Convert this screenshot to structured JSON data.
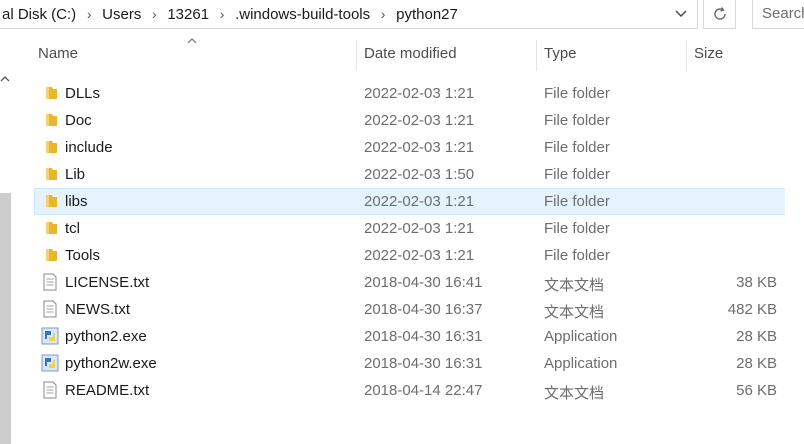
{
  "breadcrumb": [
    "al Disk (C:)",
    "Users",
    "13261",
    ".windows-build-tools",
    "python27"
  ],
  "search_placeholder": "Search",
  "columns": {
    "name": "Name",
    "date": "Date modified",
    "type": "Type",
    "size": "Size"
  },
  "files": [
    {
      "name": "DLLs",
      "date": "2022-02-03 1:21",
      "type": "File folder",
      "size": "",
      "icon": "folder-icon"
    },
    {
      "name": "Doc",
      "date": "2022-02-03 1:21",
      "type": "File folder",
      "size": "",
      "icon": "folder-icon"
    },
    {
      "name": "include",
      "date": "2022-02-03 1:21",
      "type": "File folder",
      "size": "",
      "icon": "folder-icon"
    },
    {
      "name": "Lib",
      "date": "2022-02-03 1:50",
      "type": "File folder",
      "size": "",
      "icon": "folder-icon"
    },
    {
      "name": "libs",
      "date": "2022-02-03 1:21",
      "type": "File folder",
      "size": "",
      "icon": "folder-icon",
      "selected": true
    },
    {
      "name": "tcl",
      "date": "2022-02-03 1:21",
      "type": "File folder",
      "size": "",
      "icon": "folder-icon"
    },
    {
      "name": "Tools",
      "date": "2022-02-03 1:21",
      "type": "File folder",
      "size": "",
      "icon": "folder-icon"
    },
    {
      "name": "LICENSE.txt",
      "date": "2018-04-30 16:41",
      "type": "文本文档",
      "size": "38 KB",
      "icon": "text-file-icon"
    },
    {
      "name": "NEWS.txt",
      "date": "2018-04-30 16:37",
      "type": "文本文档",
      "size": "482 KB",
      "icon": "text-file-icon"
    },
    {
      "name": "python2.exe",
      "date": "2018-04-30 16:31",
      "type": "Application",
      "size": "28 KB",
      "icon": "python-app-icon"
    },
    {
      "name": "python2w.exe",
      "date": "2018-04-30 16:31",
      "type": "Application",
      "size": "28 KB",
      "icon": "python-app-icon"
    },
    {
      "name": "README.txt",
      "date": "2018-04-14 22:47",
      "type": "文本文档",
      "size": "56 KB",
      "icon": "text-file-icon"
    }
  ],
  "colors": {
    "selection_bg": "#e5f3ff",
    "selection_border": "#cce8ff",
    "folder": "#f5c542",
    "python_blue": "#3b73b9",
    "python_yellow": "#f3d24b"
  }
}
